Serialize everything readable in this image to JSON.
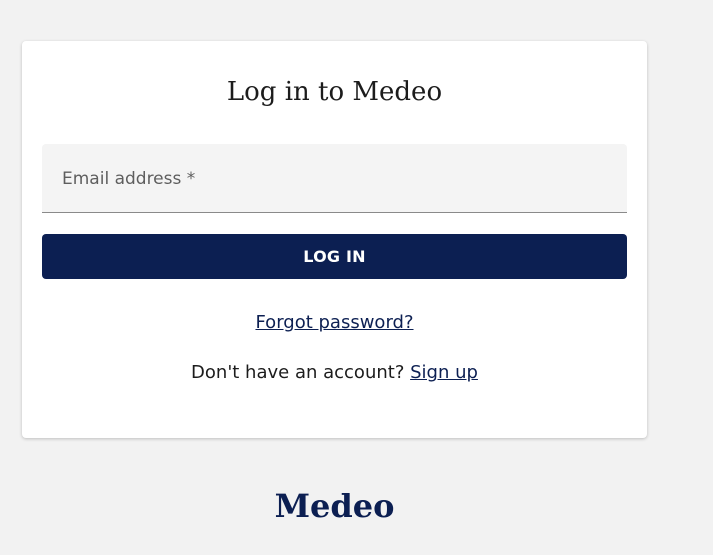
{
  "login": {
    "title": "Log in to Medeo",
    "email": {
      "label": "Email address *",
      "value": ""
    },
    "login_button": "LOG IN",
    "forgot_password": "Forgot password?",
    "signup_prompt": "Don't have an account?",
    "signup_link": "Sign up"
  },
  "footer": {
    "logo": "Medeo"
  },
  "colors": {
    "brand": "#0c1f52",
    "background": "#f2f2f2",
    "card": "#ffffff",
    "field_background": "#f4f4f4"
  }
}
